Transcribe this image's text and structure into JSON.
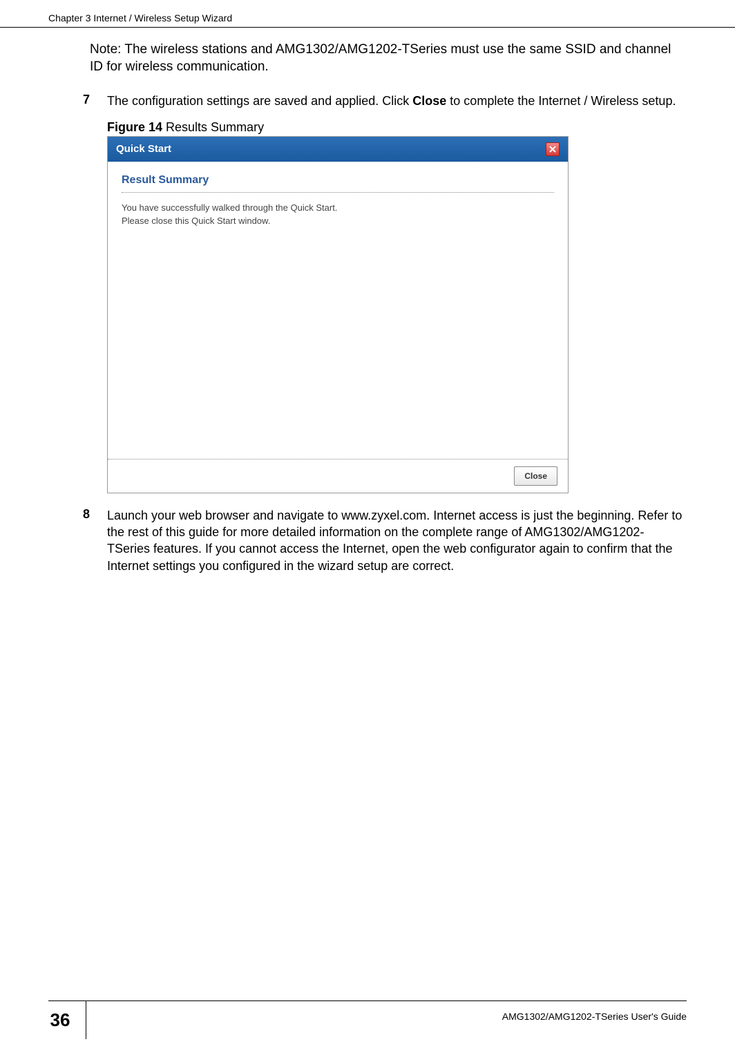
{
  "header": {
    "chapter": "Chapter 3 Internet / Wireless Setup Wizard"
  },
  "note": {
    "prefix": "Note: ",
    "text": "The wireless stations and AMG1302/AMG1202-TSeries must use the same SSID and channel ID for wireless communication."
  },
  "step7": {
    "num": "7",
    "text_before": "The configuration settings are saved and applied. Click ",
    "bold": "Close",
    "text_after": " to complete the Internet / Wireless setup."
  },
  "figure": {
    "prefix": "Figure 14   ",
    "caption": "Results Summary"
  },
  "screenshot": {
    "title": "Quick Start",
    "heading": "Result Summary",
    "line1": "You have successfully walked through the Quick Start.",
    "line2": "Please close this Quick Start window.",
    "close_btn": "Close"
  },
  "step8": {
    "num": "8",
    "text": "Launch your web browser and navigate to www.zyxel.com. Internet access is just the beginning. Refer to the rest of this guide for more detailed information on the complete range of AMG1302/AMG1202-TSeries features. If you cannot access the Internet, open the web configurator again to confirm that the Internet settings you configured in the wizard setup are correct."
  },
  "footer": {
    "page_num": "36",
    "guide": "AMG1302/AMG1202-TSeries User's Guide"
  }
}
